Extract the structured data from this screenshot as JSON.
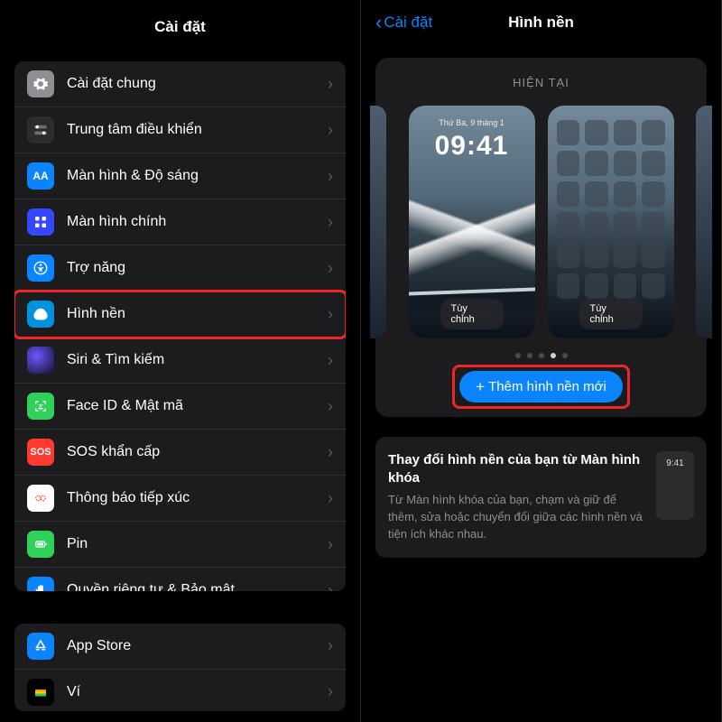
{
  "left": {
    "title": "Cài đặt",
    "rows1": [
      {
        "label": "Cài đặt chung",
        "name": "settings-row-general",
        "icon": "gear-icon"
      },
      {
        "label": "Trung tâm điều khiển",
        "name": "settings-row-control-center",
        "icon": "toggles-icon"
      },
      {
        "label": "Màn hình & Độ sáng",
        "name": "settings-row-display",
        "icon": "aa-icon"
      },
      {
        "label": "Màn hình chính",
        "name": "settings-row-home-screen",
        "icon": "grid-icon"
      },
      {
        "label": "Trợ năng",
        "name": "settings-row-accessibility",
        "icon": "accessibility-icon"
      },
      {
        "label": "Hình nền",
        "name": "settings-row-wallpaper",
        "icon": "wallpaper-icon"
      },
      {
        "label": "Siri & Tìm kiếm",
        "name": "settings-row-siri",
        "icon": "siri-icon"
      },
      {
        "label": "Face ID & Mật mã",
        "name": "settings-row-faceid",
        "icon": "faceid-icon"
      },
      {
        "label": "SOS khẩn cấp",
        "name": "settings-row-sos",
        "icon": "sos-icon"
      },
      {
        "label": "Thông báo tiếp xúc",
        "name": "settings-row-exposure",
        "icon": "exposure-icon"
      },
      {
        "label": "Pin",
        "name": "settings-row-battery",
        "icon": "battery-icon"
      },
      {
        "label": "Quyền riêng tư & Bảo mật",
        "name": "settings-row-privacy",
        "icon": "hand-icon"
      }
    ],
    "rows2": [
      {
        "label": "App Store",
        "name": "settings-row-appstore",
        "icon": "appstore-icon"
      },
      {
        "label": "Ví",
        "name": "settings-row-wallet",
        "icon": "wallet-icon"
      }
    ]
  },
  "right": {
    "back": "Cài đặt",
    "title": "Hình nền",
    "current_label": "HIỆN TẠI",
    "lock_date": "Thứ Ba, 9 tháng 1",
    "lock_time": "09:41",
    "customize": "Tùy chỉnh",
    "add_label": "Thêm hình nền mới",
    "info_title": "Thay đổi hình nền của bạn từ Màn hình khóa",
    "info_desc": "Từ Màn hình khóa của bạn, chạm và giữ để thêm, sửa hoặc chuyển đổi giữa các hình nền và tiện ích khác nhau.",
    "mini_time": "9:41",
    "dots": {
      "count": 5,
      "active": 3
    }
  }
}
